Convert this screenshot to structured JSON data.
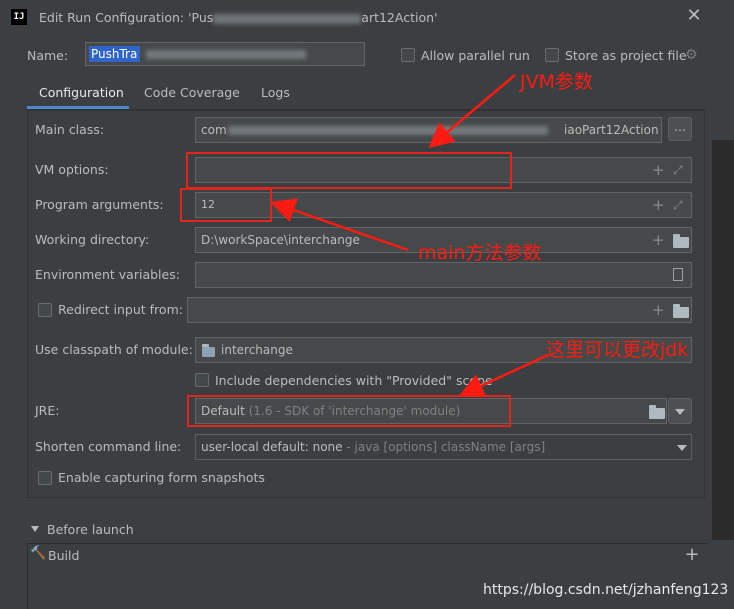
{
  "window": {
    "title": "Edit Run Configuration: 'Pus",
    "title_tail": "art12Action'",
    "app_icon": "IJ"
  },
  "top": {
    "name_label": "Name:",
    "name_value": "PushTra",
    "allow_parallel_label": "Allow parallel run",
    "store_project_label": "Store as project file"
  },
  "tabs": [
    {
      "label": "Configuration"
    },
    {
      "label": "Code Coverage"
    },
    {
      "label": "Logs"
    }
  ],
  "form": {
    "main_class_label": "Main class:",
    "main_class_value_start": "com",
    "main_class_value_end": "iaoPart12Action",
    "browse_label": "...",
    "vm_options_label": "VM options:",
    "program_args_label": "Program arguments:",
    "program_args_value": "12",
    "working_dir_label": "Working directory:",
    "working_dir_value": "D:\\workSpace\\interchange",
    "env_vars_label": "Environment variables:",
    "redirect_label": "Redirect input from:",
    "classpath_label": "Use classpath of module:",
    "classpath_value": "interchange",
    "include_deps_label": "Include dependencies with \"Provided\" scope",
    "jre_label": "JRE:",
    "jre_value": "Default",
    "jre_hint": "(1.6 - SDK of 'interchange' module)",
    "shorten_label": "Shorten command line:",
    "shorten_value": "user-local default: none",
    "shorten_hint": "- java [options] className [args]",
    "snapshots_label": "Enable capturing form snapshots"
  },
  "before_launch": {
    "header": "Before launch",
    "item": "Build",
    "add": "+"
  },
  "annotations": {
    "jvm": "JVM参数",
    "main": "main方法参数",
    "jdk": "这里可以更改jdk"
  },
  "watermark": "https://blog.csdn.net/jzhanfeng123",
  "colors": {
    "background": "#3c3f41",
    "annotation_red": "#e2241c",
    "tab_accent": "#4a88c7",
    "selection_blue": "#2f65ca"
  }
}
